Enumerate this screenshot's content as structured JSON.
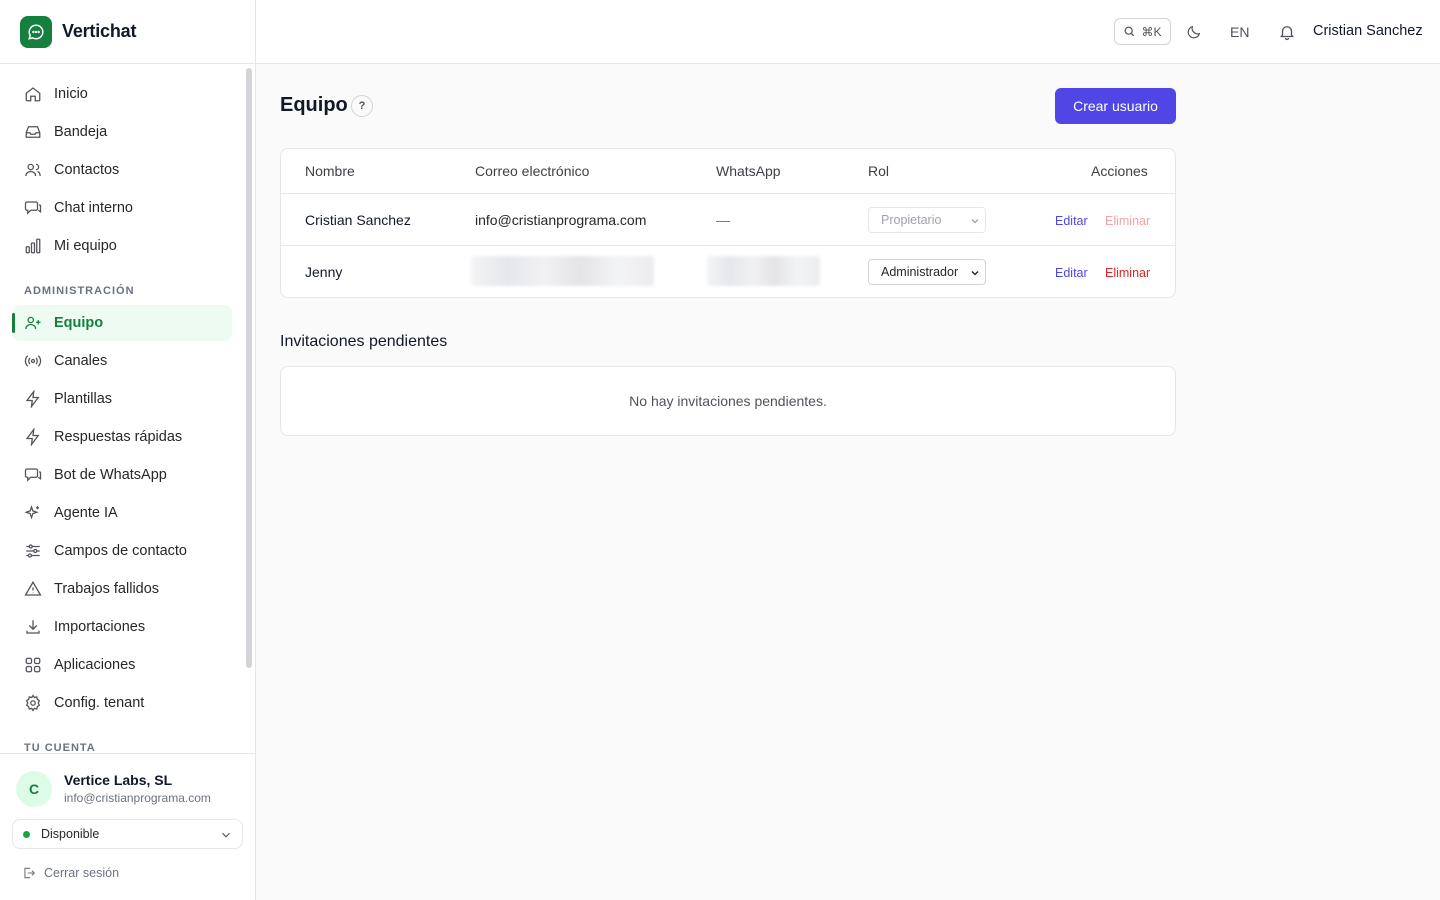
{
  "app": {
    "name": "Vertichat"
  },
  "header": {
    "search_shortcut": "⌘K",
    "language": "EN",
    "user_name": "Cristian Sanchez"
  },
  "sidebar": {
    "items": [
      {
        "label": "Inicio",
        "icon": "home-icon"
      },
      {
        "label": "Bandeja",
        "icon": "inbox-icon"
      },
      {
        "label": "Contactos",
        "icon": "users-icon"
      },
      {
        "label": "Chat interno",
        "icon": "chat-icon"
      },
      {
        "label": "Mi equipo",
        "icon": "bar-chart-icon"
      }
    ],
    "admin_section_label": "ADMINISTRACIÓN",
    "admin_items": [
      {
        "label": "Equipo",
        "icon": "user-plus-icon",
        "active": true
      },
      {
        "label": "Canales",
        "icon": "radio-icon"
      },
      {
        "label": "Plantillas",
        "icon": "bolt-icon"
      },
      {
        "label": "Respuestas rápidas",
        "icon": "bolt-icon"
      },
      {
        "label": "Bot de WhatsApp",
        "icon": "chat-icon"
      },
      {
        "label": "Agente IA",
        "icon": "sparkles-icon"
      },
      {
        "label": "Campos de contacto",
        "icon": "sliders-icon"
      },
      {
        "label": "Trabajos fallidos",
        "icon": "warning-icon"
      },
      {
        "label": "Importaciones",
        "icon": "download-icon"
      },
      {
        "label": "Aplicaciones",
        "icon": "apps-icon"
      },
      {
        "label": "Config. tenant",
        "icon": "gear-icon"
      }
    ],
    "account_section_label": "TU CUENTA",
    "account": {
      "avatar_initial": "C",
      "name": "Vertice Labs, SL",
      "email": "info@cristianprograma.com",
      "status": "Disponible",
      "logout_label": "Cerrar sesión"
    }
  },
  "main": {
    "title": "Equipo",
    "help_label": "?",
    "create_button": "Crear usuario",
    "table": {
      "columns": [
        "Nombre",
        "Correo electrónico",
        "WhatsApp",
        "Rol",
        "Acciones"
      ],
      "rows": [
        {
          "name": "Cristian Sanchez",
          "email": "info@cristianprograma.com",
          "whatsapp": "—",
          "role": "Propietario",
          "edit": "Editar",
          "delete": "Eliminar"
        },
        {
          "name": "Jenny",
          "email": "",
          "whatsapp": "",
          "role": "Administrador",
          "edit": "Editar",
          "delete": "Eliminar"
        }
      ]
    },
    "invitations": {
      "title": "Invitaciones pendientes",
      "empty_text": "No hay invitaciones pendientes."
    }
  },
  "colors": {
    "brand": "#15803d",
    "primary": "#4f46e5",
    "danger": "#dc2626"
  }
}
